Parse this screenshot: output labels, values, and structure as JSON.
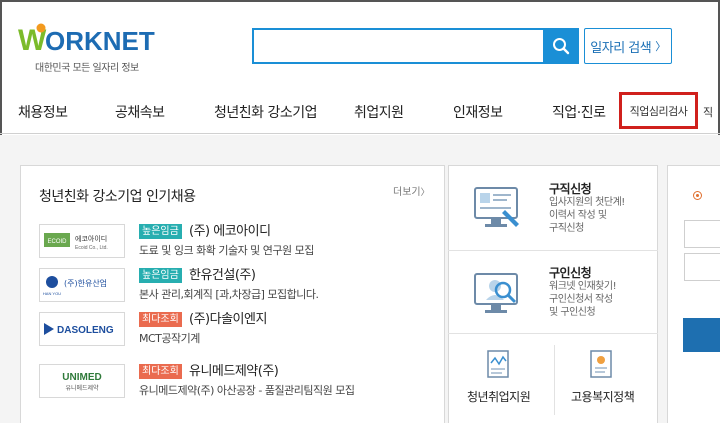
{
  "header": {
    "logo_text": "WORKNET",
    "logo_sub": "대한민국 모든 일자리 정보",
    "search_placeholder": "",
    "search_button_icon": "search-icon",
    "job_search_label": "일자리 검색",
    "job_search_arrow": "〉"
  },
  "nav": {
    "items": [
      "채용정보",
      "공채속보",
      "청년친화 강소기업",
      "취업지원",
      "인재정보",
      "직업·진로"
    ],
    "highlighted": "직업심리검사",
    "overflow": "직"
  },
  "main": {
    "panel_title": "청년친화 강소기업 인기채용",
    "more_label": "더보기",
    "more_arrow": "〉",
    "jobs": [
      {
        "logo": "에코아이디",
        "logo_sub": "Ecoid Co., Ltd.",
        "badge": "높은임금",
        "badge_color": "#27aeb0",
        "company": "(주) 에코아이디",
        "desc": "도료 및 잉크 화확 기술자 및 연구원 모집"
      },
      {
        "logo": "(주)한유산업",
        "logo_sub": "HAN YOU",
        "badge": "높은임금",
        "badge_color": "#27aeb0",
        "company": "한유건설(주)",
        "desc": "본사 관리,회계직 [과,차장급] 모집합니다."
      },
      {
        "logo": "DASOLENG",
        "logo_sub": "",
        "badge": "최다조회",
        "badge_color": "#ea6b4f",
        "company": "(주)다솔이엔지",
        "desc": "MCT공작기계"
      },
      {
        "logo": "UNIMED",
        "logo_sub": "유니메드제약",
        "badge": "최다조회",
        "badge_color": "#ea6b4f",
        "company": "유니메드제약(주)",
        "desc": "유니메드제약(주) 아산공장 - 품질관리팀직원 모집"
      }
    ]
  },
  "services": {
    "job_apply": {
      "title": "구직신청",
      "desc": "입사지원의 첫단계!\n이력서 작성 및\n구직신청"
    },
    "recruit_apply": {
      "title": "구인신청",
      "desc": "워크넷 인재찾기!\n구인신청서 작성\n및 구인신청"
    },
    "youth_support": "청년취업지원",
    "employment_policy": "고용복지정책"
  },
  "colors": {
    "accent": "#1a8fd6",
    "highlight_border": "#d0201c",
    "badge_teal": "#27aeb0",
    "badge_red": "#ea6b4f"
  }
}
